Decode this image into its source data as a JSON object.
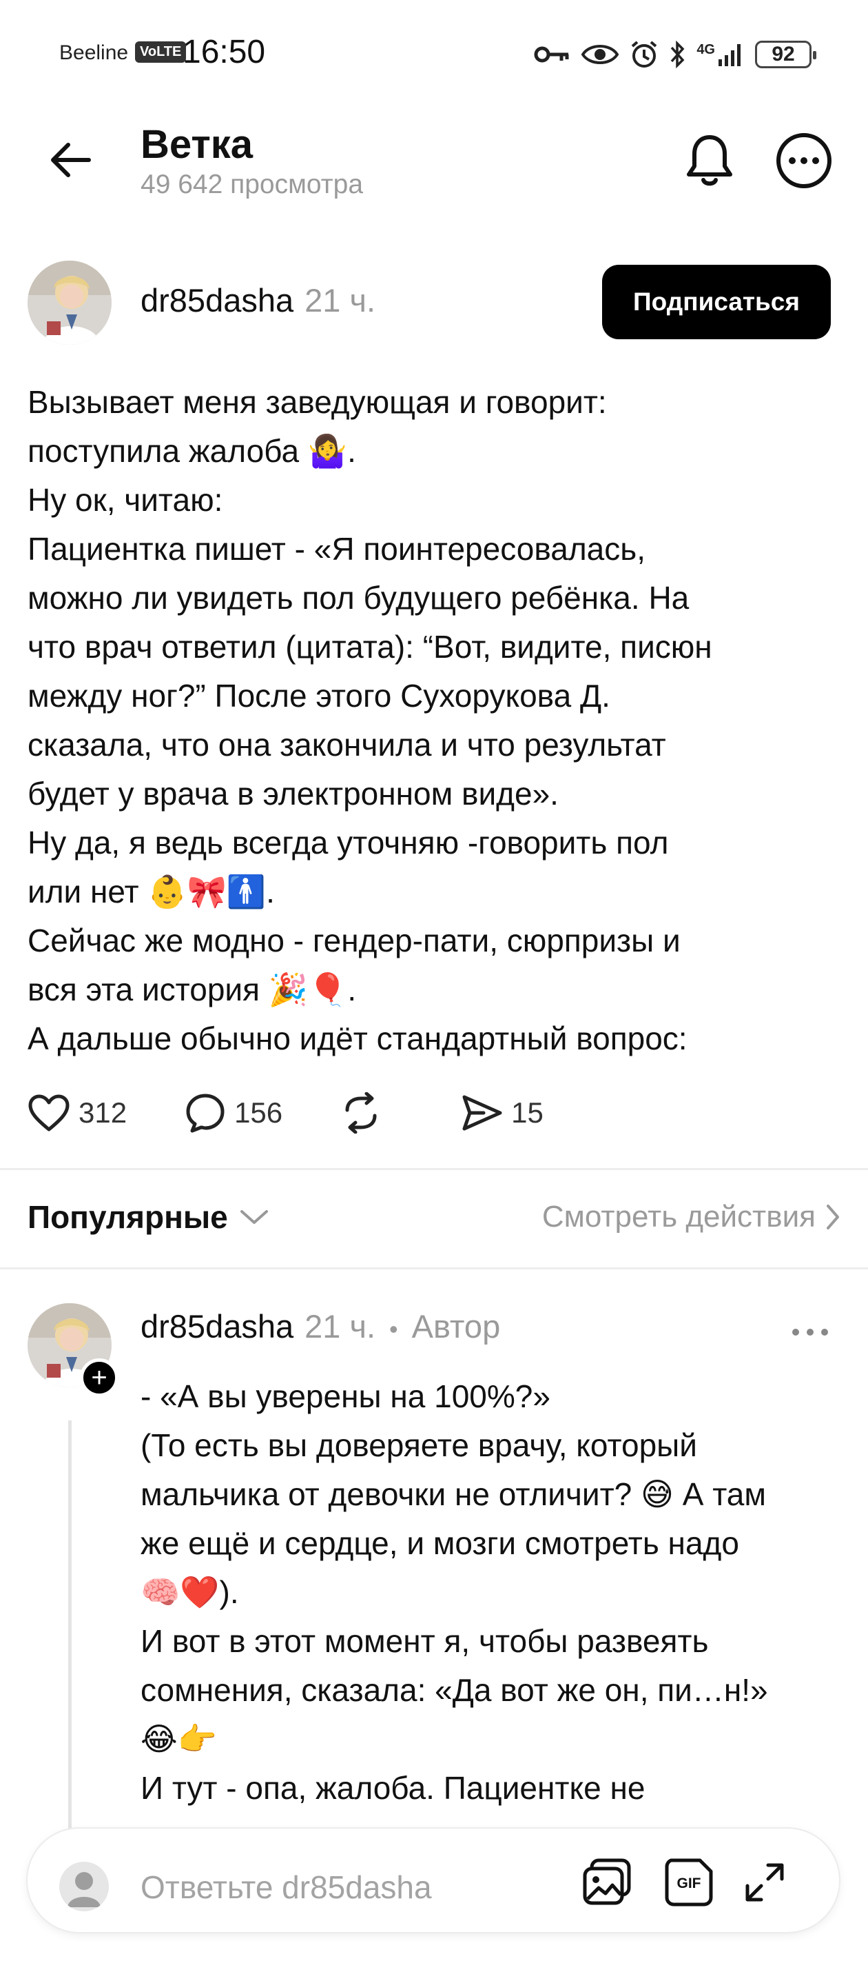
{
  "status_bar": {
    "carrier": "Beeline",
    "volte": "VoLTE",
    "time": "16:50",
    "network": "4G",
    "battery": "92",
    "icons": [
      "key-icon",
      "eye-icon",
      "alarm-icon",
      "bluetooth-icon",
      "signal-icon",
      "battery-icon"
    ]
  },
  "header": {
    "title": "Ветка",
    "subtitle": "49 642 просмотра",
    "icons": [
      "back-arrow-icon",
      "bell-icon",
      "more-icon"
    ]
  },
  "post": {
    "username": "dr85dasha",
    "time": "21 ч.",
    "follow_label": "Подписаться",
    "lines": [
      "Вызывает меня заведующая и говорит:",
      "поступила жалоба 🤷‍♀️.",
      "Ну ок, читаю:",
      "Пациентка пишет - «Я поинтересовалась,",
      "можно ли увидеть пол будущего ребёнка. На",
      "что врач ответил (цитата): “Вот, видите, писюн",
      "между ног?” После этого Сухорукова Д.",
      "сказала, что она закончила и что результат",
      "будет у врача в электронном виде».",
      "Ну да, я ведь всегда уточняю -говорить пол",
      "или нет 👶🎀🚹.",
      "Сейчас же модно - гендер-пати, сюрпризы и",
      "вся эта история 🎉🎈.",
      "А дальше обычно идёт стандартный вопрос:"
    ],
    "likes": "312",
    "comments": "156",
    "shares": "15"
  },
  "sort": {
    "label": "Популярные",
    "view_actions": "Смотреть действия"
  },
  "comment": {
    "username": "dr85dasha",
    "time": "21 ч.",
    "dot": "•",
    "author_badge": "Автор",
    "lines": [
      "- «А вы уверены на 100%?»",
      "(То есть вы доверяете врачу, который",
      "мальчика от девочки не отличит? 😅 А там",
      "же ещё и сердце, и мозги смотреть надо",
      "🧠❤️).",
      "И вот в этот момент я, чтобы развеять",
      "сомнения, сказала: «Да вот же он, пи…н!»",
      "😂👉",
      "И тут - опа, жалоба. Пациентке не"
    ]
  },
  "reply": {
    "placeholder": "Ответьте dr85dasha",
    "icons": [
      "image-icon",
      "gif-icon",
      "expand-icon"
    ]
  },
  "colors": {
    "text": "#111111",
    "muted": "#9a9a9a",
    "button": "#000000",
    "divider": "#ededed"
  }
}
